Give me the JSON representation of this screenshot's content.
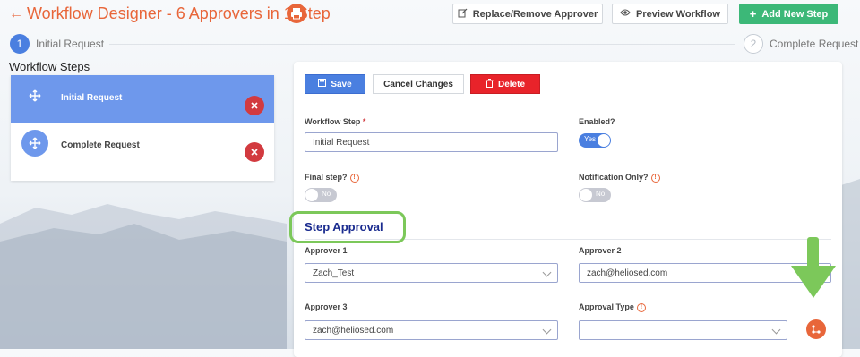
{
  "header": {
    "title": "Workflow Designer - 6 Approvers in 1 Step",
    "buttons": {
      "replace": "Replace/Remove Approver",
      "preview": "Preview Workflow",
      "add": "Add New Step"
    }
  },
  "stepper": [
    {
      "number": "1",
      "label": "Initial Request"
    },
    {
      "number": "2",
      "label": "Complete Request"
    }
  ],
  "sidebar": {
    "heading": "Workflow Steps",
    "items": [
      {
        "label": "Initial Request"
      },
      {
        "label": "Complete Request"
      }
    ]
  },
  "form": {
    "actions": {
      "save": "Save",
      "cancel": "Cancel Changes",
      "delete": "Delete"
    },
    "workflow_step": {
      "label": "Workflow Step",
      "required": "*",
      "value": "Initial Request"
    },
    "enabled": {
      "label": "Enabled?",
      "state": "Yes"
    },
    "final_step": {
      "label": "Final step?",
      "state": "No"
    },
    "notification_only": {
      "label": "Notification Only?",
      "state": "No"
    },
    "approval_section": "Step Approval",
    "approver1": {
      "label": "Approver 1",
      "value": "Zach_Test"
    },
    "approver2": {
      "label": "Approver 2",
      "value": "zach@heliosed.com"
    },
    "approver3": {
      "label": "Approver 3",
      "value": "zach@heliosed.com"
    },
    "approval_type": {
      "label": "Approval Type",
      "value": ""
    }
  },
  "colors": {
    "brand": "#e8663a",
    "primary": "#4a7fe0",
    "success": "#3cb878",
    "danger": "#e8232a",
    "highlight": "#7cc85a"
  },
  "icons": [
    "back-arrow-icon",
    "print-icon",
    "edit-icon",
    "eye-icon",
    "plus-icon",
    "move-icon",
    "close-icon",
    "save-icon",
    "trash-icon",
    "info-icon",
    "chevron-down-icon",
    "workflow-icon",
    "arrow-down-icon"
  ]
}
